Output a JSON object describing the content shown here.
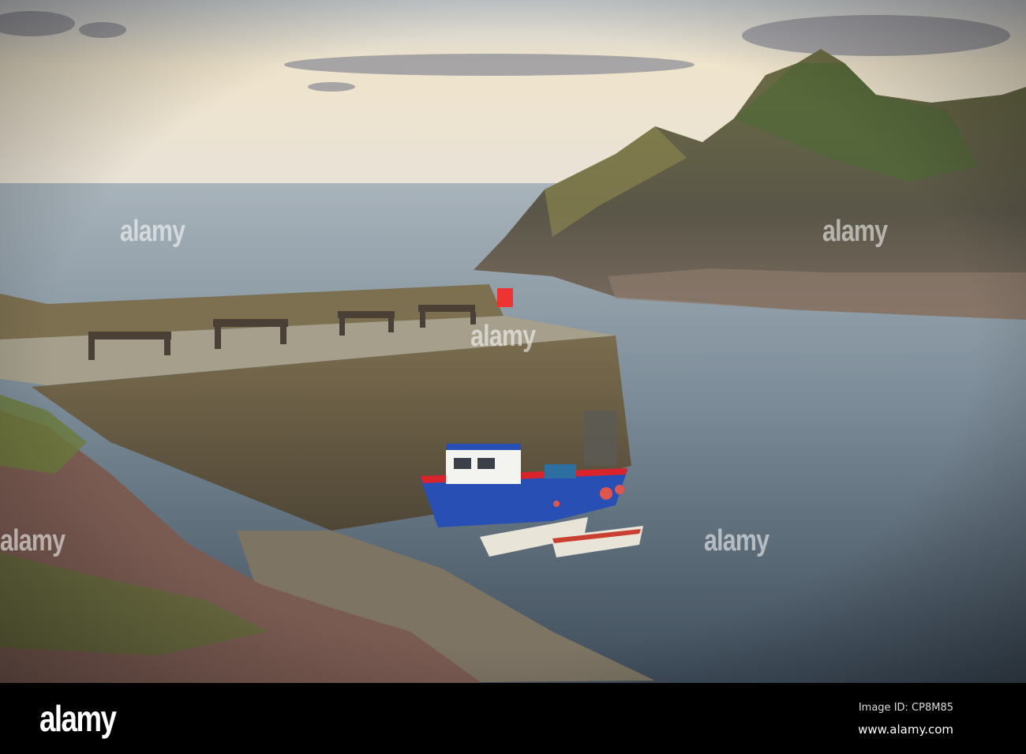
{
  "photo": {
    "description_alt": "Harbour pier with fishing boat and rocky headland",
    "watermark_text": "alamy"
  },
  "footer": {
    "logo": "alamy",
    "image_id": "Image ID: CP8M85",
    "url": "www.alamy.com"
  },
  "colors": {
    "boat_hull": "#2850b4",
    "boat_stripe": "#d8242a",
    "sea": "#5a6a78",
    "sky": "#efe6d2"
  }
}
